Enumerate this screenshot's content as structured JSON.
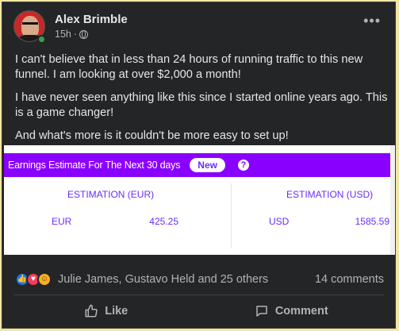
{
  "post": {
    "author": "Alex Brimble",
    "time": "15h",
    "separator": "·",
    "more": "•••",
    "paragraphs": [
      "I can't believe that in less than 24 hours of running traffic to this new funnel. I am looking at over $2,000 a month!",
      "I have never seen anything like this since I started online years ago. This is a game changer!",
      "And what's more is it couldn't be more easy to set up!"
    ]
  },
  "embed": {
    "title": "Earnings Estimate For The Next 30 days",
    "badge": "New",
    "help": "?",
    "left": {
      "heading": "ESTIMATION (EUR)",
      "currency": "EUR",
      "amount": "425.25"
    },
    "right": {
      "heading": "ESTIMATION (USD)",
      "currency": "USD",
      "amount": "1585.59"
    },
    "accent_color": "#8a00ff"
  },
  "engagement": {
    "reacted_by": "Julie James, Gustavo Held and 25 others",
    "comments": "14 comments",
    "reaction_icons": [
      "like-icon",
      "love-icon",
      "care-icon"
    ]
  },
  "actions": {
    "like": "Like",
    "comment": "Comment"
  }
}
